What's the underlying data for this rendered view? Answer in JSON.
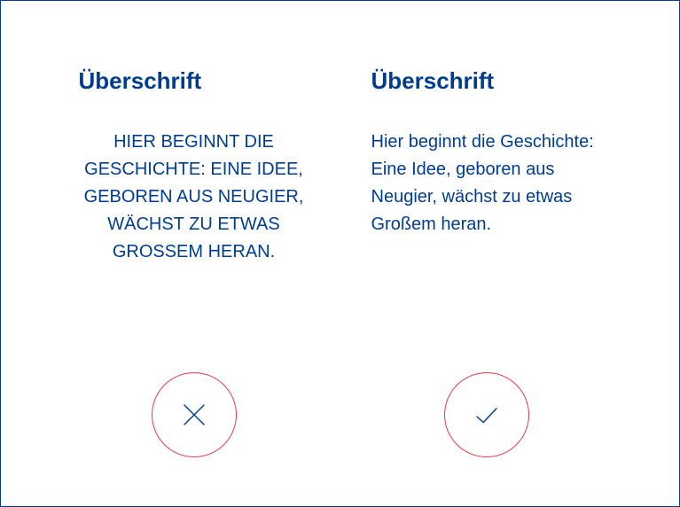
{
  "colors": {
    "primary": "#003d8f",
    "accent": "#e63946",
    "background": "#ffffff"
  },
  "columns": [
    {
      "heading": "Überschrift",
      "body": "HIER BEGINNT DIE GESCHICHTE: EINE IDEE, GEBOREN AUS NEUGIER, WÄCHST ZU ETWAS GROSSEM HERAN.",
      "icon": "cross-icon",
      "verdict": "wrong"
    },
    {
      "heading": "Überschrift",
      "body": "Hier beginnt die Geschichte: Eine Idee, geboren aus Neugier, wächst zu etwas Großem heran.",
      "icon": "check-icon",
      "verdict": "correct"
    }
  ]
}
